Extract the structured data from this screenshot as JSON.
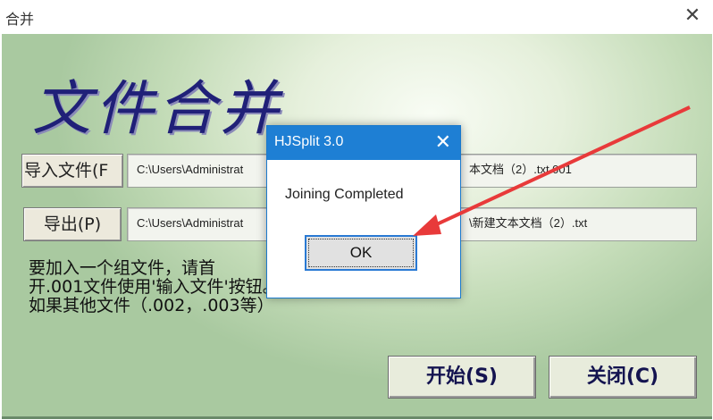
{
  "window": {
    "title": "合并",
    "close_glyph": "✕"
  },
  "main": {
    "heading": "文件合并",
    "input_button": "导入文件(F",
    "input_path_left": "C:\\Users\\Administrat",
    "input_path_right": "本文档（2）.txt.001",
    "output_button": "导出(P)",
    "output_path_left": "C:\\Users\\Administrat",
    "output_path_right": "\\新建文本文档（2）.txt",
    "help_line1": "要加入一个组文件，请首",
    "help_line2": "开.001文件使用'输入文件'按钮。",
    "help_line3": "如果其他文件（.002，.003等）",
    "start_button": "开始(S)",
    "close_button": "关闭(C)"
  },
  "dialog": {
    "title": "HJSplit 3.0",
    "close_glyph": "✕",
    "message": "Joining Completed",
    "ok_label": "OK"
  },
  "annotation": {
    "arrow_color": "#e83a3a"
  },
  "icons": {
    "window_close": "close-icon",
    "dialog_close": "close-icon"
  }
}
